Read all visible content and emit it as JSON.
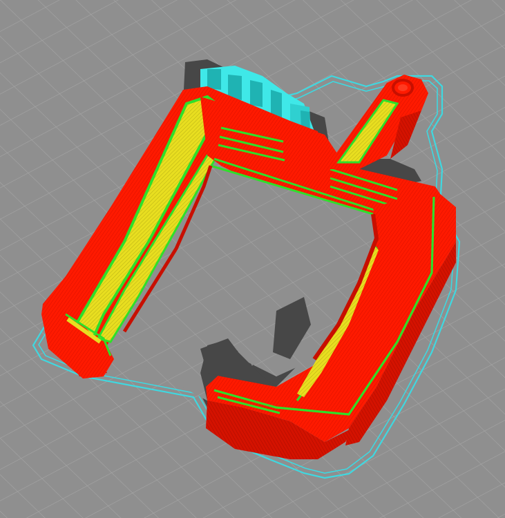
{
  "viewport": {
    "description_free": true,
    "view_mode": "layer-preview",
    "colors": {
      "build_plate": "#8f8f8f",
      "grid_line": "#a3a3a3",
      "shadow": "#4a4a4a",
      "shell": "#ff1a00",
      "shell_dark": "#c80f00",
      "infill": "#e8e02a",
      "inner_wall": "#2ee02a",
      "support": "#3fe8e8",
      "support_dark": "#1fb3b3",
      "skirt": "#3fd8e0"
    }
  }
}
